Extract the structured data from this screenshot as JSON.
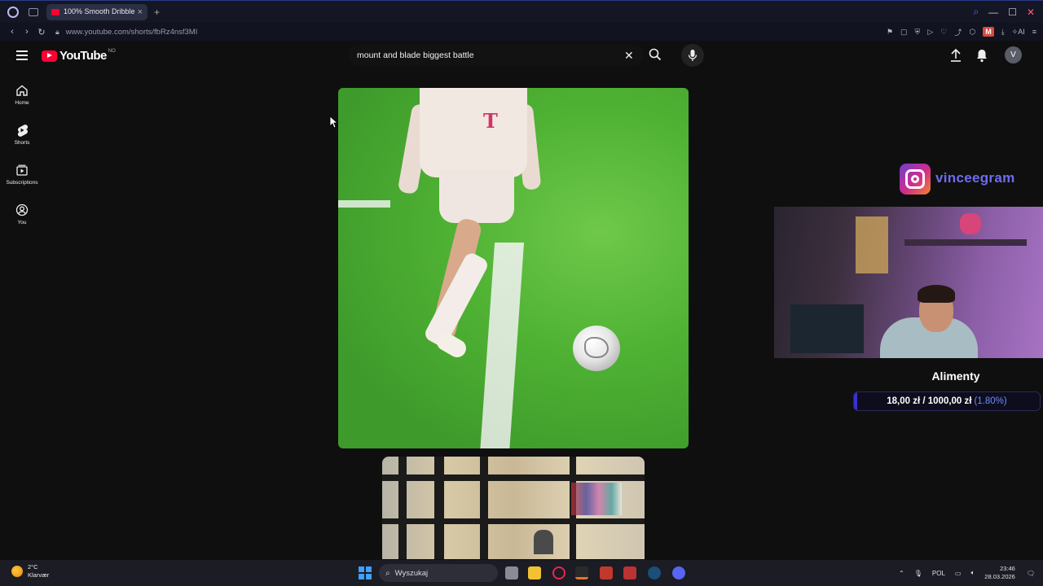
{
  "browser": {
    "tab_title": "100% Smooth Dribble 🪄",
    "new_tab": "+",
    "url": "www.youtube.com/shorts/fbRz4nsf3MI",
    "ext_badge": "M",
    "ai_label": "AI"
  },
  "youtube": {
    "logo_text": "YouTube",
    "logo_country": "NO",
    "search_value": "mount and blade biggest battle",
    "avatar_letter": "V",
    "sidebar": [
      {
        "label": "Home"
      },
      {
        "label": "Shorts"
      },
      {
        "label": "Subscriptions"
      },
      {
        "label": "You"
      }
    ]
  },
  "overlay": {
    "instagram_handle": "vinceegram",
    "donation_title": "Alimenty",
    "donation_amount": "18,00 zł / 1000,00 zł",
    "donation_percent": "(1.80%)",
    "donation_progress": 0.018
  },
  "taskbar": {
    "temperature": "2°C",
    "weather_location": "Klarvær",
    "search_placeholder": "Wyszukaj",
    "language": "POL",
    "time": "23:46",
    "date": "28.03.2026"
  },
  "colors": {
    "youtube_red": "#ff0033",
    "instagram_text": "#6f6cf0",
    "donation_fill": "#3a2fd6",
    "taskbar_bg": "#1b1c24"
  }
}
